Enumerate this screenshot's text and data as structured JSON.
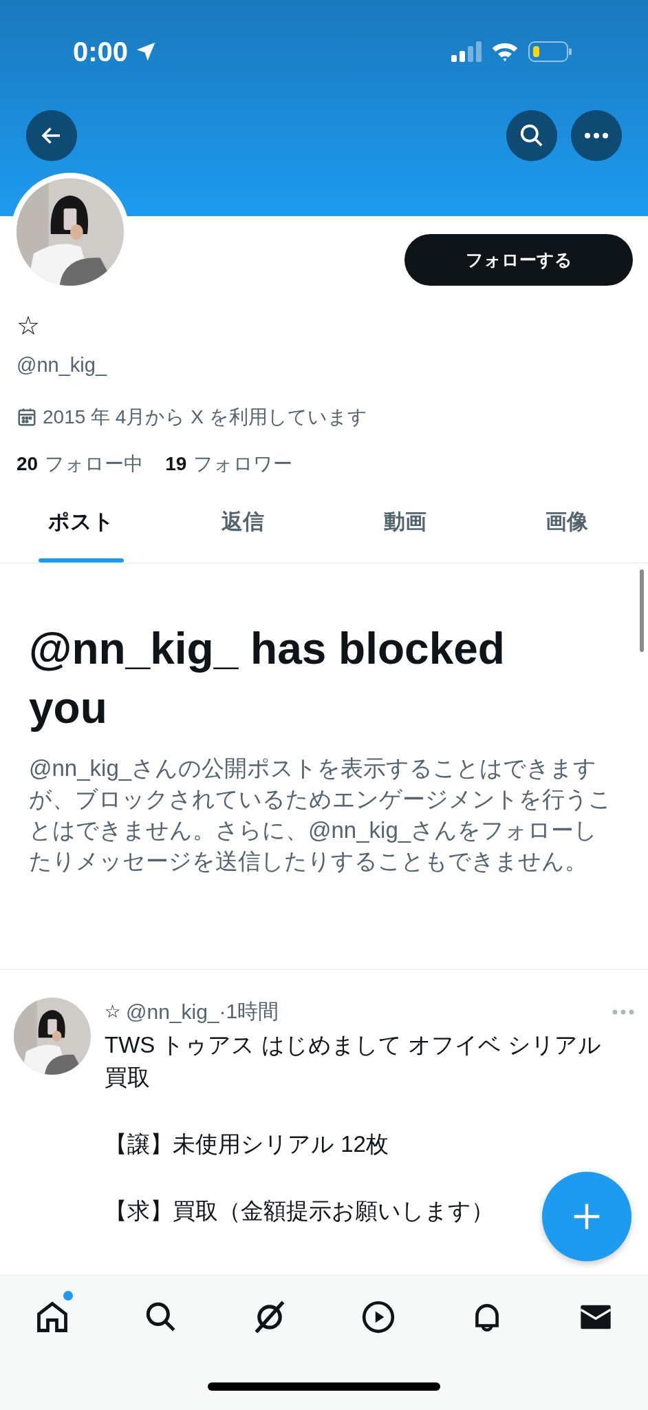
{
  "status_bar": {
    "time": "0:00"
  },
  "profile": {
    "display_name": "☆",
    "handle": "@nn_kig_",
    "follow_button": "フォローする",
    "joined": "2015 年 4月から X を利用しています",
    "following_count": "20",
    "following_label": "フォロー中",
    "followers_count": "19",
    "followers_label": "フォロワー"
  },
  "tabs": [
    {
      "label": "ポスト",
      "selected": true
    },
    {
      "label": "返信",
      "selected": false
    },
    {
      "label": "動画",
      "selected": false
    },
    {
      "label": "画像",
      "selected": false
    }
  ],
  "blocked_notice": {
    "title": "@nn_kig_ has blocked you",
    "body": "@nn_kig_さんの公開ポストを表示することはできますが、ブロックされているためエンゲージメントを行うことはできません。さらに、@nn_kig_さんをフォローしたりメッセージを送信したりすることもできません。"
  },
  "post": {
    "name": "☆",
    "handle": "@nn_kig_",
    "time": "·1時間",
    "lines": [
      "TWS トゥアス はじめまして オフイベ シリアル買取",
      "【譲】未使用シリアル 12枚",
      "【求】買取（金額提示お願いします）"
    ]
  },
  "bottom_nav": {
    "home_badge": true
  }
}
